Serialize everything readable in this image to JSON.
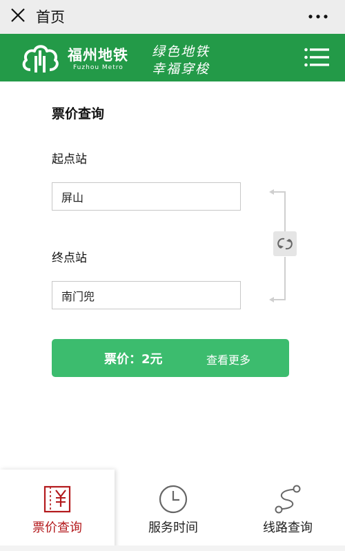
{
  "topbar": {
    "title": "首页",
    "close_icon": "close-icon",
    "more_icon": "more-dots-icon"
  },
  "header": {
    "brand_cn": "福州地铁",
    "brand_en": "Fuzhou Metro",
    "slogan_line1": "绿色地铁",
    "slogan_line2": "幸福穿梭",
    "menu_icon": "hamburger-menu-icon",
    "colors": {
      "header_bg": "#239a48",
      "price_bar": "#3cbc6e",
      "active_tab": "#b3191c"
    }
  },
  "fare_query": {
    "title": "票价查询",
    "from_label": "起点站",
    "from_value": "屏山",
    "to_label": "终点站",
    "to_value": "南门兜",
    "swap_icon": "swap-stations-icon",
    "price_text": "票价：2元",
    "more_text": "查看更多"
  },
  "tabs": [
    {
      "label": "票价查询",
      "icon": "ticket-yen-icon",
      "active": true
    },
    {
      "label": "服务时间",
      "icon": "clock-icon",
      "active": false
    },
    {
      "label": "线路查询",
      "icon": "route-icon",
      "active": false
    }
  ]
}
